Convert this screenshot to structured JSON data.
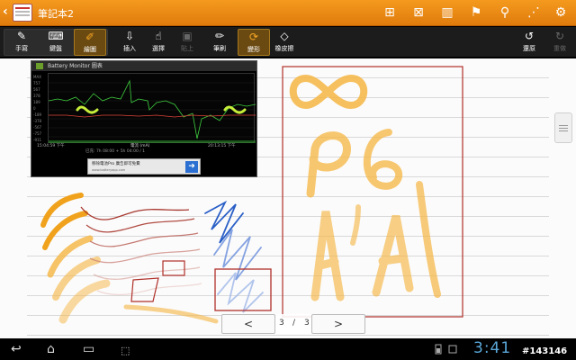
{
  "app": {
    "title": "筆記本2"
  },
  "toolbar": {
    "handwrite": "手寫",
    "keyboard": "鍵盤",
    "draw": "繪圖",
    "insert": "插入",
    "select": "選擇",
    "paste": "貼上",
    "brush": "筆刷",
    "shape": "變形",
    "eraser": "橡皮擦",
    "undo": "還原",
    "redo": "重做"
  },
  "embedded": {
    "title": "Battery Monitor 圖表",
    "y_labels": [
      "MAX",
      "757",
      "567",
      "378",
      "189",
      "0",
      "-189",
      "-378",
      "-567",
      "-757",
      "-911"
    ],
    "time_start": "15:04:59 下午",
    "axis_label": "電流 (mA)",
    "time_end": "20:13:15 下午",
    "status_line": "已充: 7h 08:00 + 5h 04:00 / 1",
    "ad_text": "移除電池Pro 廣告即可免費",
    "ad_url": "www.batteryapp.com"
  },
  "pager": {
    "current": "3",
    "separator": "/",
    "total": "3",
    "prev": "<",
    "next": ">"
  },
  "status": {
    "clock": "3:41",
    "watermark": "#143146"
  },
  "colors": {
    "accent": "#f39c1d",
    "ink_orange": "#f4a51f",
    "ink_brown": "#a8382f",
    "ink_blue": "#2a5fc7",
    "box_red": "#b0302a"
  },
  "icons": [
    "back-icon",
    "new-page-icon",
    "delete-page-icon",
    "book-icon",
    "bookmark-icon",
    "search-icon",
    "share-icon",
    "settings-icon",
    "home-icon",
    "recent-apps-icon",
    "battery-icon",
    "wifi-icon"
  ]
}
